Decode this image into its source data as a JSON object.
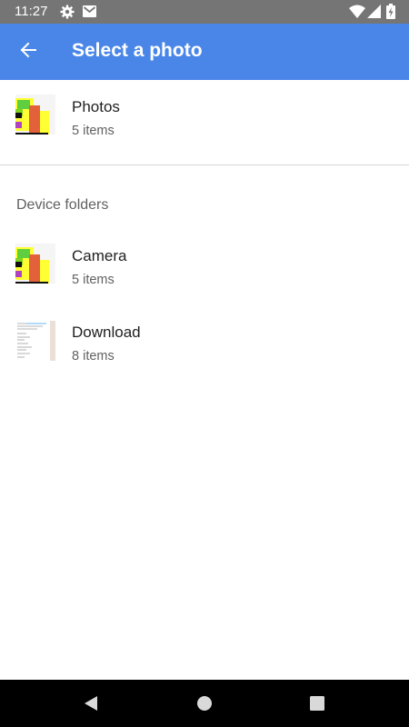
{
  "status_bar": {
    "time": "11:27",
    "icons": [
      "gear-icon",
      "mail-icon",
      "wifi-icon",
      "signal-icon",
      "battery-charging-icon"
    ]
  },
  "app_bar": {
    "back_icon": "arrow-left-icon",
    "title": "Select a photo"
  },
  "albums": [
    {
      "name": "Photos",
      "count": "5 items",
      "thumbnail": "chart-thumbnail"
    }
  ],
  "section_header": "Device folders",
  "device_folders": [
    {
      "name": "Camera",
      "count": "5 items",
      "thumbnail": "chart-thumbnail"
    },
    {
      "name": "Download",
      "count": "8 items",
      "thumbnail": "document-thumbnail"
    }
  ],
  "nav_bar": {
    "icons": [
      "back-triangle-icon",
      "home-circle-icon",
      "recents-square-icon"
    ]
  },
  "colors": {
    "app_bar": "#4a86e8",
    "status_bar": "#757575",
    "nav_bar": "#000000"
  }
}
